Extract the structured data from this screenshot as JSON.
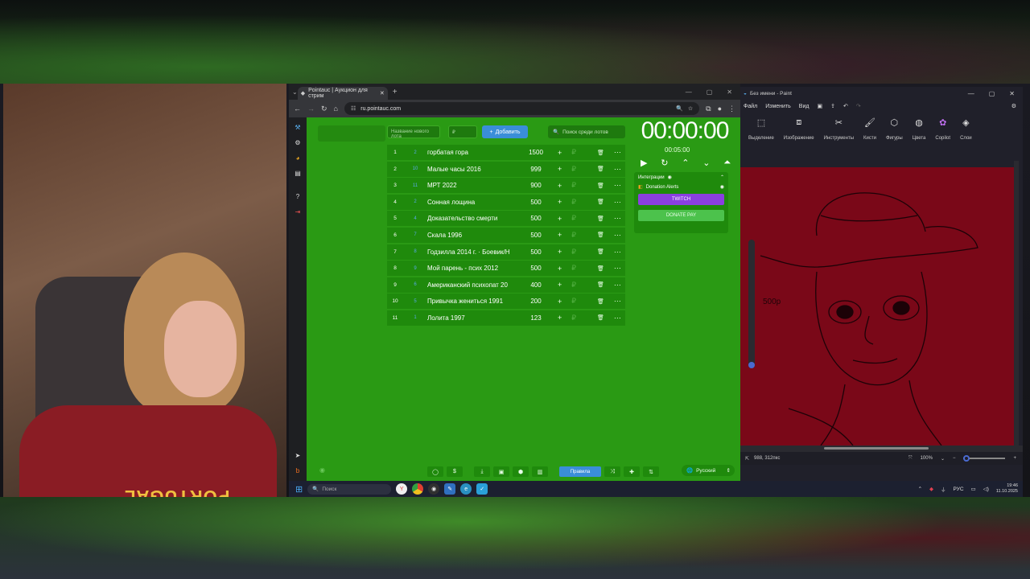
{
  "browser": {
    "tab_title": "Pointauc | Аукцион для стрим",
    "url": "ru.pointauc.com"
  },
  "auction": {
    "new_lot_placeholder": "Название нового лота",
    "amount_placeholder": "₽",
    "add_label": "Добавить",
    "search_placeholder": "Поиск среди лотов",
    "lots": [
      {
        "num": "1",
        "tag": "2",
        "name": "горбатая гора",
        "amount": "1500"
      },
      {
        "num": "2",
        "tag": "10",
        "name": "Малые часы 2016",
        "amount": "999"
      },
      {
        "num": "3",
        "tag": "11",
        "name": "МРТ 2022",
        "amount": "900"
      },
      {
        "num": "4",
        "tag": "2",
        "name": "Сонная лощина",
        "amount": "500"
      },
      {
        "num": "5",
        "tag": "4",
        "name": "Доказательство смерти",
        "amount": "500"
      },
      {
        "num": "6",
        "tag": "7",
        "name": "Скала 1996",
        "amount": "500"
      },
      {
        "num": "7",
        "tag": "8",
        "name": "Годзилла 2014 г. · Боевик/Н",
        "amount": "500"
      },
      {
        "num": "8",
        "tag": "9",
        "name": "Мой парень - псих 2012",
        "amount": "500"
      },
      {
        "num": "9",
        "tag": "6",
        "name": "Американский психопат 20",
        "amount": "400"
      },
      {
        "num": "10",
        "tag": "5",
        "name": "Привычка жениться 1991",
        "amount": "200"
      },
      {
        "num": "11",
        "tag": "1",
        "name": "Лолита 1997",
        "amount": "123"
      }
    ],
    "timer": "00:00:00",
    "subtimer": "00:05:00",
    "integrations_label": "Интеграции",
    "donation_alerts_label": "Donation Alerts",
    "twitch_label": "TWITCH",
    "donatepay_label": "DONATE PAY",
    "rules_label": "Правила",
    "language_label": "Русский"
  },
  "paint": {
    "title": "Без имени - Paint",
    "menu": [
      "Файл",
      "Изменить",
      "Вид"
    ],
    "tools": [
      "Выделение",
      "Изображение",
      "Инструменты",
      "Кисти",
      "Фигуры",
      "Цвета",
      "Copilot",
      "Слои"
    ],
    "canvas_text": "500р",
    "coords": "988, 312пкс",
    "zoom": "100%"
  },
  "taskbar": {
    "search_placeholder": "Поиск",
    "lang": "РУС",
    "time": "19:46",
    "date": "11.10.2025"
  },
  "webcam": {
    "shirt_text": "PORTUGAL"
  },
  "colors": {
    "auction_bg": "#2a9a14",
    "lot_bg": "#1f8a0c",
    "add_button": "#3a8ed8",
    "twitch": "#8a3fe0",
    "donatepay": "#4cc24c",
    "paint_canvas": "#7a0818"
  }
}
